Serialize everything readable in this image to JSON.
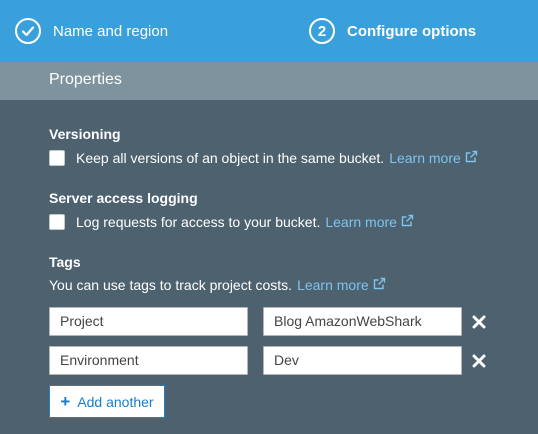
{
  "steps": [
    {
      "label": "Name and region",
      "icon": "check-circle-icon"
    },
    {
      "number": "2",
      "label": "Configure options"
    }
  ],
  "section": {
    "title": "Properties"
  },
  "versioning": {
    "heading": "Versioning",
    "checkbox_label": "Keep all versions of an object in the same bucket.",
    "checked": false,
    "link": "Learn more"
  },
  "logging": {
    "heading": "Server access logging",
    "checkbox_label": "Log requests for access to your bucket.",
    "checked": false,
    "link": "Learn more"
  },
  "tags": {
    "heading": "Tags",
    "description": "You can use tags to track project costs.",
    "link": "Learn more",
    "rows": [
      {
        "key": "Project",
        "value": "Blog AmazonWebShark"
      },
      {
        "key": "Environment",
        "value": "Dev"
      }
    ],
    "add_label": "Add another"
  },
  "colors": {
    "header": "#3aa0dc",
    "section_bar": "#7f939e",
    "background": "#4d616e",
    "link": "#7fc4ee",
    "button_border": "#1a83d0"
  }
}
